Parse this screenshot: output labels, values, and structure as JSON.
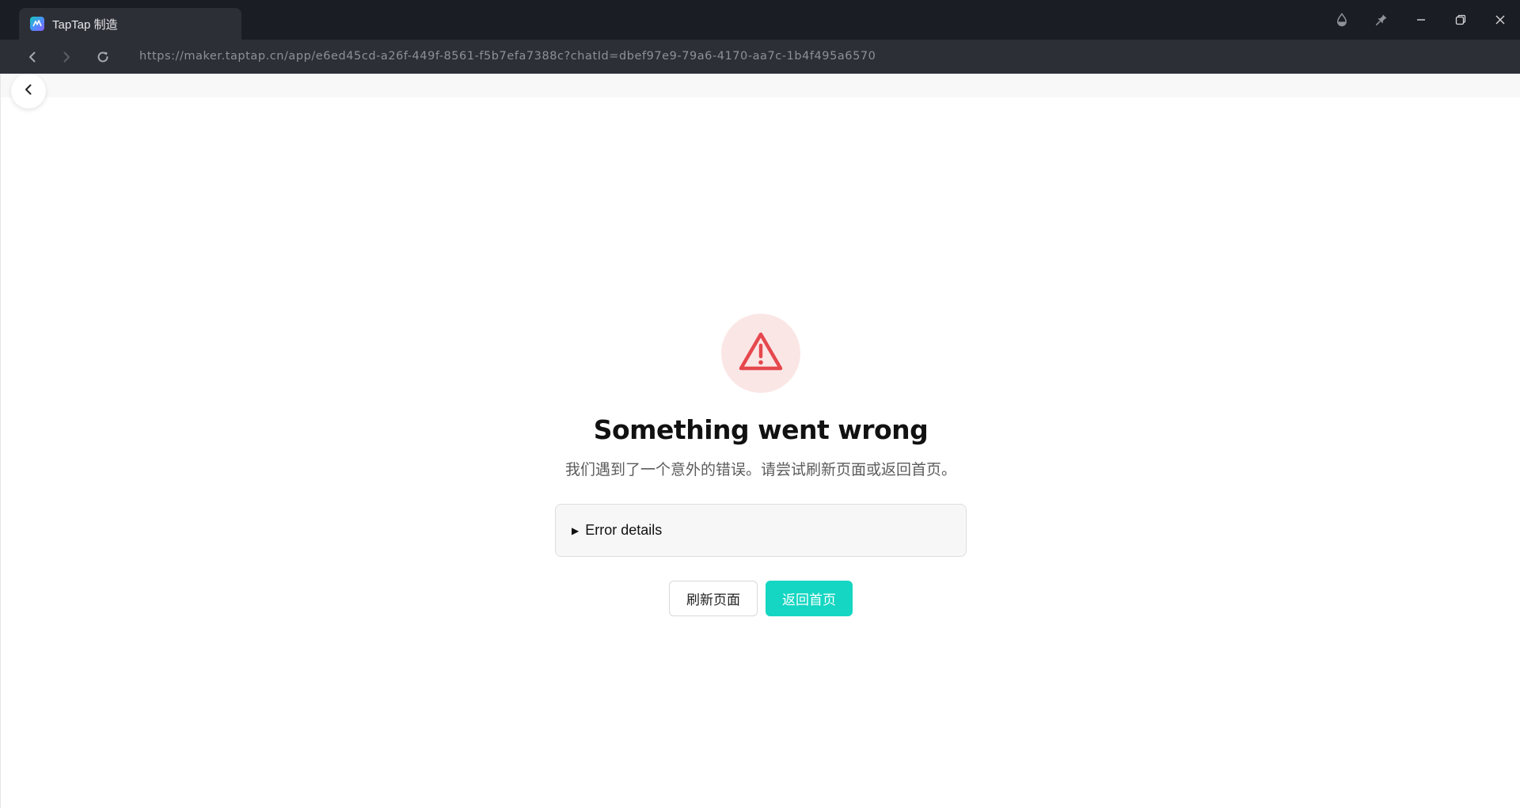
{
  "browser": {
    "tab": {
      "title": "TapTap 制造",
      "favicon_icon": "taptap-maker-logo-icon"
    },
    "url": "https://maker.taptap.cn/app/e6ed45cd-a26f-449f-8561-f5b7efa7388c?chatId=dbef97e9-79a6-4170-aa7c-1b4f495a6570",
    "nav_icons": [
      "back-arrow-icon",
      "forward-arrow-icon",
      "reload-icon"
    ],
    "window_controls": [
      "droplet-icon",
      "pin-icon",
      "minimize-icon",
      "restore-icon",
      "close-icon"
    ]
  },
  "page": {
    "back_icon": "chevron-left-icon",
    "error": {
      "icon": "warning-triangle-icon",
      "title": "Something went wrong",
      "message": "我们遇到了一个意外的错误。请尝试刷新页面或返回首页。",
      "details_label": "Error details"
    },
    "buttons": {
      "refresh_label": "刷新页面",
      "home_label": "返回首页"
    }
  },
  "colors": {
    "titlebar_bg": "#1b1d24",
    "addrbar_bg": "#2d2f37",
    "accent": "#15d6c2",
    "error_red": "#e5484d",
    "error_icon_bg": "#fbe6e6"
  }
}
